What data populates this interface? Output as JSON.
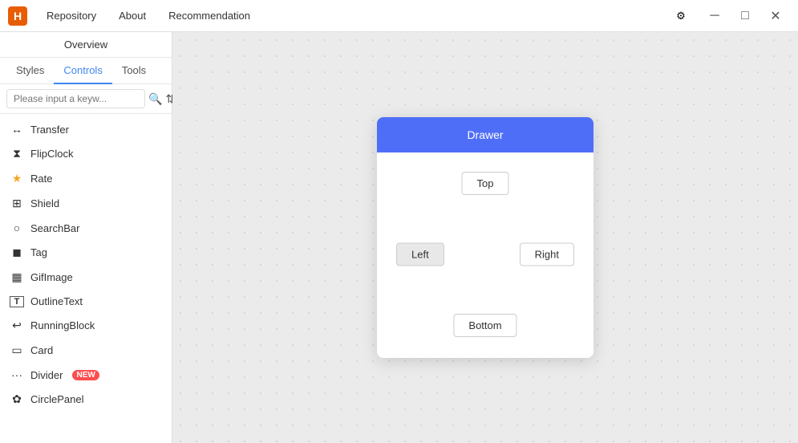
{
  "titlebar": {
    "logo": "H",
    "nav": [
      {
        "label": "Repository"
      },
      {
        "label": "About"
      },
      {
        "label": "Recommendation"
      }
    ],
    "settings_icon": "⚙",
    "minimize_icon": "─",
    "maximize_icon": "□",
    "close_icon": "✕"
  },
  "sidebar": {
    "overview_label": "Overview",
    "tabs": [
      {
        "label": "Styles",
        "active": false
      },
      {
        "label": "Controls",
        "active": true
      },
      {
        "label": "Tools",
        "active": false
      }
    ],
    "search_placeholder": "Please input a keyw...",
    "items": [
      {
        "label": "Transfer",
        "icon": "↔"
      },
      {
        "label": "FlipClock",
        "icon": "⧖"
      },
      {
        "label": "Rate",
        "icon": "★"
      },
      {
        "label": "Shield",
        "icon": "⊡"
      },
      {
        "label": "SearchBar",
        "icon": "🔍"
      },
      {
        "label": "Tag",
        "icon": "🏷"
      },
      {
        "label": "GifImage",
        "icon": "🎞"
      },
      {
        "label": "OutlineText",
        "icon": "T"
      },
      {
        "label": "RunningBlock",
        "icon": "↩"
      },
      {
        "label": "Card",
        "icon": "▭"
      },
      {
        "label": "Divider",
        "icon": "⋯",
        "badge": "NEW"
      },
      {
        "label": "CirclePanel",
        "icon": "✿"
      }
    ]
  },
  "drawer_demo": {
    "header": "Drawer",
    "buttons": {
      "top": "Top",
      "right": "Right",
      "bottom": "Bottom",
      "left": "Left"
    }
  }
}
